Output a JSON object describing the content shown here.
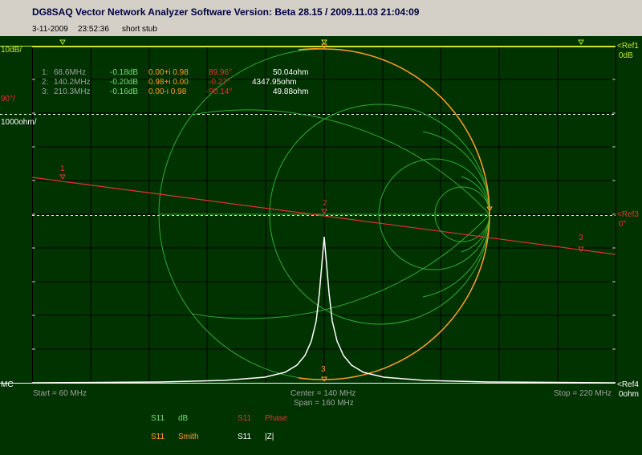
{
  "window": {
    "title": "DG8SAQ Vector Network Analyzer Software   Version:  Beta 28.15 / 2009.11.03 21:04:09"
  },
  "info": {
    "date": "3-11-2009",
    "time": "23:52:36",
    "label": "short stub"
  },
  "scale": {
    "left_db": "10dB/",
    "left_phase": "90°/",
    "left_ohm": "1000ohm/",
    "left_bottom": "MC",
    "right_ref1": "<Ref1",
    "right_ref1_val": "0dB",
    "right_ref3": "<Ref3",
    "right_ref3_val": "0°",
    "right_ref4": "<Ref4",
    "right_ref4_val": "0ohm"
  },
  "markers": [
    {
      "index": "1:",
      "freq": "68.6MHz",
      "db": "-0.18dB",
      "smith": "0.00+i 0.98",
      "phase": "89.96°",
      "z": "50.04ohm"
    },
    {
      "index": "2:",
      "freq": "140.2MHz",
      "db": "-0.20dB",
      "smith": "0.98+i 0.00",
      "phase": "-0.27°",
      "z": "4347.95ohm"
    },
    {
      "index": "3:",
      "freq": "210.3MHz",
      "db": "-0.16dB",
      "smith": "0.00-i 0.98",
      "phase": "-90.14°",
      "z": "49.88ohm"
    }
  ],
  "axis": {
    "start": "Start = 60 MHz",
    "center": "Center = 140 MHz",
    "span": "Span = 160 MHz",
    "stop": "Stop = 220 MHz"
  },
  "legend": [
    {
      "param": "S11",
      "type": "dB",
      "color": "#78dc78"
    },
    {
      "param": "S11",
      "type": "Phase",
      "color": "#e63232"
    },
    {
      "param": "S11",
      "type": "Smith",
      "color": "#ff9c2a"
    },
    {
      "param": "S11",
      "type": "|Z|",
      "color": "#ffffff"
    }
  ],
  "marker_labels": {
    "m1": "1",
    "m2": "2",
    "m3": "3"
  },
  "colors": {
    "background": "#003300",
    "grid": "#000000",
    "db_trace": "#c8e632",
    "phase_trace": "#e63232",
    "smith_trace": "#ff9c2a",
    "z_trace": "#ffffff",
    "smith_grid": "#3cbe3c"
  }
}
